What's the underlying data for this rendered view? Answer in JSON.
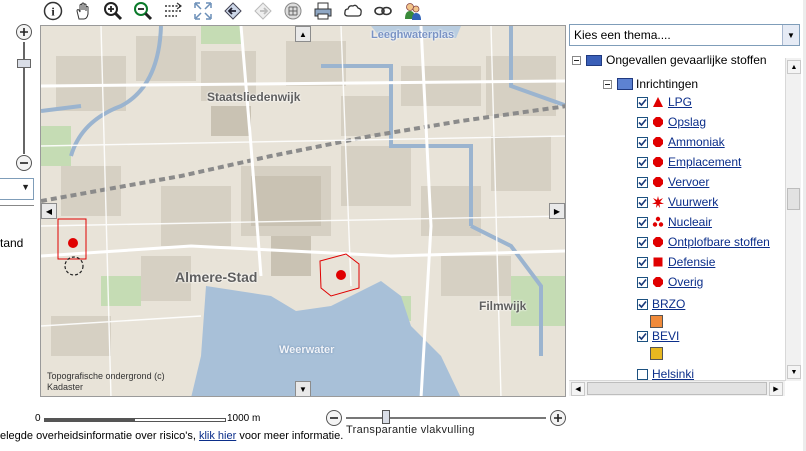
{
  "toolbar": {
    "tools": [
      {
        "name": "info-icon"
      },
      {
        "name": "pan-hand-icon"
      },
      {
        "name": "zoom-in-icon"
      },
      {
        "name": "zoom-out-icon"
      },
      {
        "name": "measure-icon"
      },
      {
        "name": "full-extent-icon"
      },
      {
        "name": "back-icon"
      },
      {
        "name": "forward-icon"
      },
      {
        "name": "grid-icon"
      },
      {
        "name": "print-icon"
      },
      {
        "name": "cloud-icon"
      },
      {
        "name": "link-icon"
      },
      {
        "name": "users-icon"
      }
    ]
  },
  "left_panel": {
    "cut_label": "tand"
  },
  "map": {
    "labels": {
      "leeghwaterplas": "Leeghwaterplas",
      "staatsliedenwijk": "Staatsliedenwijk",
      "almere_stad": "Almere-Stad",
      "filmwijk": "Filmwijk",
      "weerwater": "Weerwater"
    },
    "attribution_line1": "Topografische ondergrond (c)",
    "attribution_line2": "Kadaster"
  },
  "scale": {
    "start": "0",
    "end": "1000 m"
  },
  "transparency": {
    "label": "Transparantie vlakvulling",
    "level": 0.08
  },
  "footer": {
    "text_before": "elegde overheidsinformatie over risico's,",
    "link": "klik hier",
    "text_after": "voor meer informatie."
  },
  "theme_select": {
    "value": "Kies een thema...."
  },
  "tree": {
    "parent_label": "Ongevallen gevaarlijke stoffen",
    "group_label": "Inrichtingen",
    "items": [
      {
        "label": "LPG",
        "checked": true,
        "icon": "triangle",
        "color": "#e00000"
      },
      {
        "label": "Opslag",
        "checked": true,
        "icon": "octagon",
        "color": "#e00000"
      },
      {
        "label": "Ammoniak",
        "checked": true,
        "icon": "octagon",
        "color": "#e00000"
      },
      {
        "label": "Emplacement",
        "checked": true,
        "icon": "octagon",
        "color": "#e00000"
      },
      {
        "label": "Vervoer",
        "checked": true,
        "icon": "octagon",
        "color": "#e00000"
      },
      {
        "label": "Vuurwerk",
        "checked": true,
        "icon": "burst",
        "color": "#e00000"
      },
      {
        "label": "Nucleair",
        "checked": true,
        "icon": "trefoil",
        "color": "#e00000"
      },
      {
        "label": "Ontplofbare stoffen",
        "checked": true,
        "icon": "octagon",
        "color": "#e00000"
      },
      {
        "label": "Defensie",
        "checked": true,
        "icon": "square",
        "color": "#e00000"
      },
      {
        "label": "Overig",
        "checked": true,
        "icon": "octagon",
        "color": "#e00000"
      }
    ],
    "extra": [
      {
        "label": "BRZO",
        "checked": true,
        "swatch": "#f08a3a"
      },
      {
        "label": "BEVI",
        "checked": true,
        "swatch": "#e8b820"
      },
      {
        "label": "Helsinki",
        "checked": false
      }
    ]
  },
  "colors": {
    "water": "#a8c0d8",
    "accent_link": "#0b2e8a",
    "risk": "#e00000"
  }
}
